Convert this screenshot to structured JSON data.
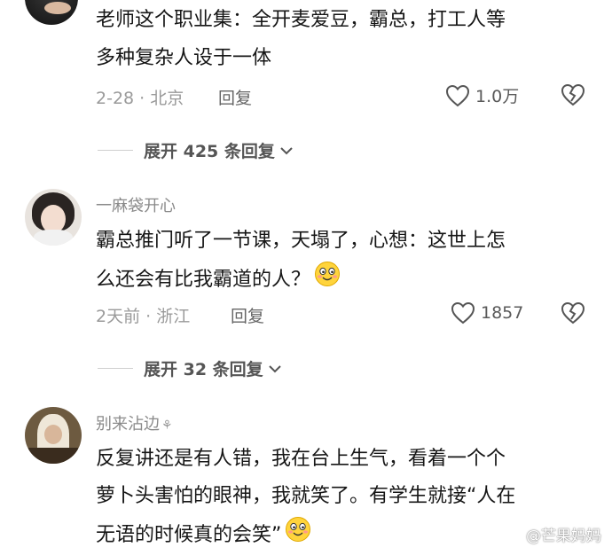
{
  "comments": [
    {
      "username": "",
      "lines": [
        "老师这个职业集：全开麦爱豆，霸总，打工人等",
        "多种复杂人设于一体"
      ],
      "meta": "2-28 · 北京",
      "reply_label": "回复",
      "likes": "1.0万"
    },
    {
      "username": "一麻袋开心",
      "lines": [
        "霸总推门听了一节课，天塌了，心想：这世上怎",
        "么还会有比我霸道的人？"
      ],
      "meta": "2天前 · 浙江",
      "reply_label": "回复",
      "likes": "1857"
    },
    {
      "username": "别来沾边",
      "lines": [
        "反复讲还是有人错，我在台上生气，看着一个个",
        "萝卜头害怕的眼神，我就笑了。有学生就接“人在",
        "无语的时候真的会笑”"
      ]
    }
  ],
  "expand_links": [
    {
      "label": "展开 425 条回复"
    },
    {
      "label": "展开 32 条回复"
    }
  ],
  "watermark": "@芒果妈妈",
  "icons": [
    "heart-icon",
    "broken-heart-icon",
    "chevron-down-icon",
    "smile-emoji-icon",
    "weibo-icon"
  ]
}
